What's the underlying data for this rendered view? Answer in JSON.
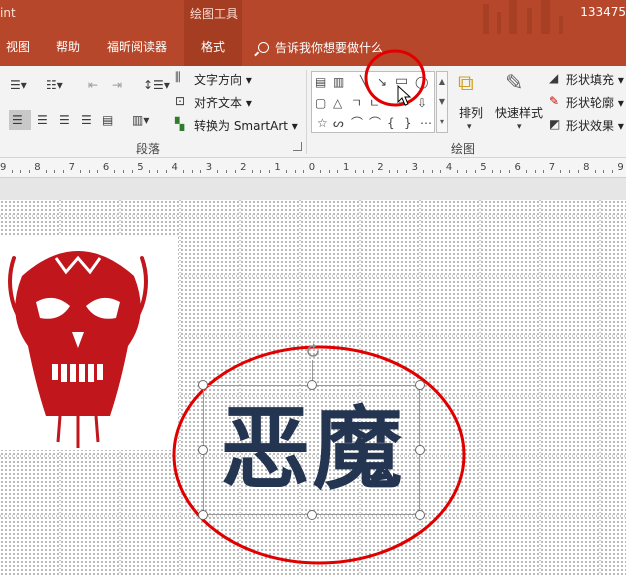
{
  "titlebar": {
    "app_partial": "int",
    "context_group": "绘图工具",
    "right_number": "133475",
    "tabs": [
      "视图",
      "帮助",
      "福昕阅读器",
      "格式"
    ],
    "active_tab": "格式",
    "tell_me": "告诉我你想要做什么"
  },
  "ribbon": {
    "paragraph_group": {
      "label": "段落",
      "text_direction": "文字方向",
      "align_text": "对齐文本",
      "convert_smartart": "转换为 SmartArt"
    },
    "drawing_group": {
      "label": "绘图",
      "arrange": "排列",
      "quick_styles": "快速样式",
      "shape_fill": "形状填充",
      "shape_outline": "形状轮廓",
      "shape_effects": "形状效果"
    }
  },
  "ruler": {
    "labels": [
      "9",
      "8",
      "7",
      "6",
      "5",
      "4",
      "3",
      "2",
      "1",
      "0",
      "1",
      "2",
      "3",
      "4",
      "5",
      "6",
      "7",
      "8",
      "9"
    ]
  },
  "slide": {
    "main_text": "恶魔"
  },
  "colors": {
    "title_bg": "#b7472a",
    "accent_text": "#243552",
    "annotation": "#e00000",
    "skull": "#c0161c"
  }
}
